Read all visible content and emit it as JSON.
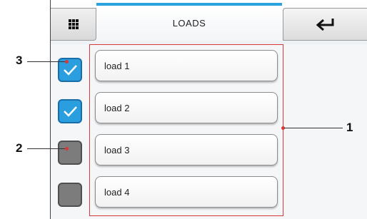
{
  "header": {
    "title": "LOADS",
    "menu_icon": "grid-icon",
    "back_icon": "return-arrow-icon"
  },
  "loads": [
    {
      "label": "load 1",
      "checked": true
    },
    {
      "label": "load 2",
      "checked": true
    },
    {
      "label": "load 3",
      "checked": false
    },
    {
      "label": "load 4",
      "checked": false
    }
  ],
  "callouts": {
    "one": "1",
    "two": "2",
    "three": "3"
  },
  "colors": {
    "accent": "#2aa3dc",
    "checkbox_on": "#2b9ee0",
    "checkbox_off": "#7c7c7c",
    "annotation": "#d9383a"
  }
}
